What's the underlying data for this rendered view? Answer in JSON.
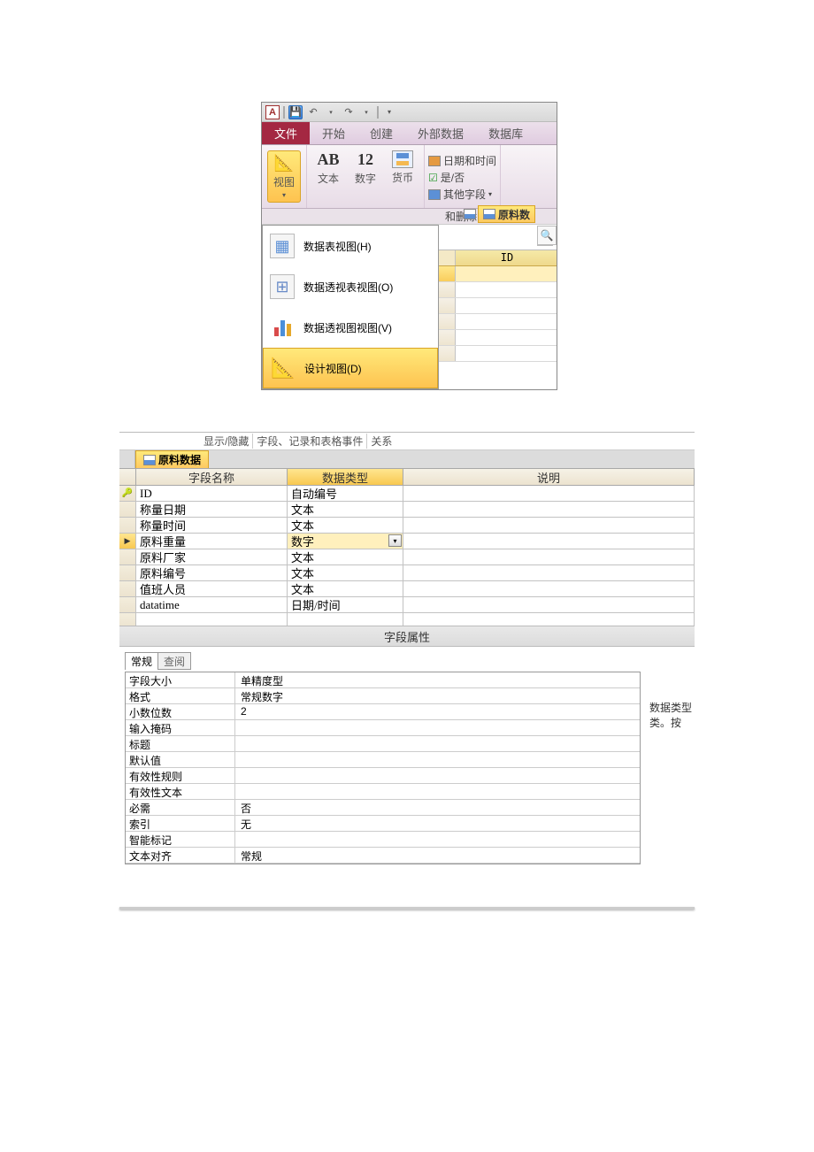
{
  "topWindow": {
    "appLetter": "A",
    "tabs": {
      "file": "文件",
      "home": "开始",
      "create": "创建",
      "external": "外部数据",
      "db": "数据库"
    },
    "ribbon": {
      "view": "视图",
      "text_btn": {
        "big": "AB",
        "label": "文本"
      },
      "num_btn": {
        "big": "12",
        "label": "数字"
      },
      "cur_btn": {
        "label": "货币"
      },
      "dt": "日期和时间",
      "yesno": "是/否",
      "other": "其他字段",
      "delete": "和删除"
    },
    "menu": {
      "datasheet": "数据表视图(H)",
      "pivotTable": "数据透视表视图(O)",
      "pivotChart": "数据透视图视图(V)",
      "design": "设计视图(D)"
    },
    "sideTab": "原料数",
    "idCol": "ID"
  },
  "bottom": {
    "groups": {
      "g1": "显示/隐藏",
      "g2": "字段、记录和表格事件",
      "g3": "关系"
    },
    "objTab": "原料数据",
    "headers": {
      "name": "字段名称",
      "type": "数据类型",
      "desc": "说明"
    },
    "rows": [
      {
        "name": "ID",
        "type": "自动编号",
        "key": true
      },
      {
        "name": "称量日期",
        "type": "文本"
      },
      {
        "name": "称量时间",
        "type": "文本"
      },
      {
        "name": "原料重量",
        "type": "数字",
        "current": true
      },
      {
        "name": "原料厂家",
        "type": "文本"
      },
      {
        "name": "原料编号",
        "type": "文本"
      },
      {
        "name": "值班人员",
        "type": "文本"
      },
      {
        "name": "datatime",
        "type": "日期/时间"
      }
    ],
    "propTitle": "字段属性",
    "tabs": {
      "general": "常规",
      "lookup": "查阅"
    },
    "props": [
      {
        "k": "字段大小",
        "v": "单精度型"
      },
      {
        "k": "格式",
        "v": "常规数字"
      },
      {
        "k": "小数位数",
        "v": "2"
      },
      {
        "k": "输入掩码",
        "v": ""
      },
      {
        "k": "标题",
        "v": ""
      },
      {
        "k": "默认值",
        "v": ""
      },
      {
        "k": "有效性规则",
        "v": ""
      },
      {
        "k": "有效性文本",
        "v": ""
      },
      {
        "k": "必需",
        "v": "否"
      },
      {
        "k": "索引",
        "v": "无"
      },
      {
        "k": "智能标记",
        "v": ""
      },
      {
        "k": "文本对齐",
        "v": "常规"
      }
    ],
    "help1": "数据类型",
    "help2": "类。按"
  }
}
